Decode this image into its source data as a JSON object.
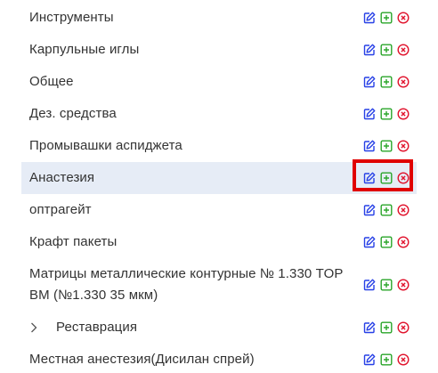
{
  "colors": {
    "edit": "#2740e6",
    "add": "#2aa52a",
    "delete": "#e0102a",
    "selected_bg": "#e6ecf6",
    "highlight": "#e00000"
  },
  "icons": {
    "edit": "edit-icon",
    "add": "add-icon",
    "delete": "delete-icon",
    "expand": "chevron-right-icon"
  },
  "items": [
    {
      "label": "Инструменты"
    },
    {
      "label": "Карпульные иглы"
    },
    {
      "label": "Общее"
    },
    {
      "label": "Дез. средства"
    },
    {
      "label": "Промывашки аспиджета"
    },
    {
      "label": "Анастезия",
      "selected": true
    },
    {
      "label": "оптрагейт"
    },
    {
      "label": "Крафт пакеты"
    },
    {
      "label": "Матрицы металлические контурные № 1.330 TOP BM (№1.330 35 мкм)"
    },
    {
      "label": "Реставрация",
      "expandable": true
    },
    {
      "label": "Местная анестезия(Дисилан спрей)"
    }
  ]
}
